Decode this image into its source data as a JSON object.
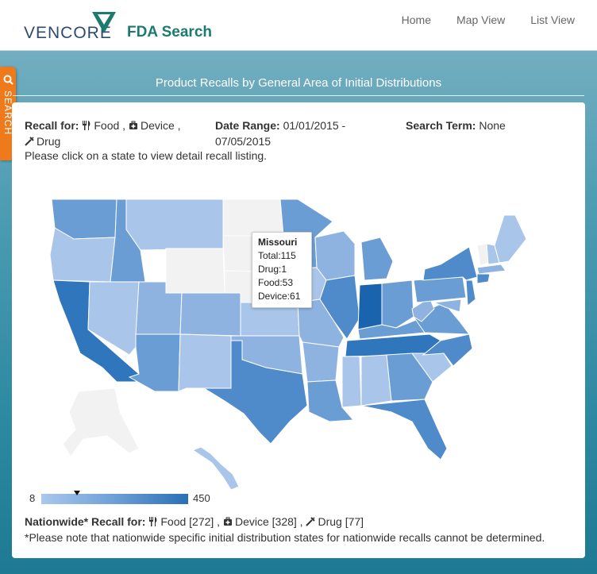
{
  "header": {
    "brand": "VENCORE",
    "app_name": "FDA Search",
    "nav": [
      "Home",
      "Map View",
      "List View"
    ]
  },
  "search_tab": {
    "label": "SEARCH"
  },
  "page": {
    "title": "Product Recalls by General Area of Initial Distributions"
  },
  "filters": {
    "recall_label": "Recall for:",
    "food": "Food",
    "device": "Device",
    "drug": "Drug",
    "date_label": "Date Range:",
    "date_value_1": "01/01/2015 -",
    "date_value_2": "07/05/2015",
    "term_label": "Search Term:",
    "term_value": "None",
    "instruction": "Please click on a state to view detail recall listing."
  },
  "tooltip": {
    "state": "Missouri",
    "total": "Total:115",
    "drug": "Drug:1",
    "food": "Food:53",
    "device": "Device:61"
  },
  "legend": {
    "min": "8",
    "max": "450",
    "marker_value": 115
  },
  "nationwide": {
    "label": "Nationwide* Recall for:",
    "food": "Food [272]",
    "device": "Device [328]",
    "drug": "Drug [77]",
    "note": "*Please note that nationwide specific initial distribution states for nationwide recalls cannot be determined."
  },
  "colors": {
    "empty": "#f2f2f2",
    "light": "#a9c6ea",
    "mid_light": "#8fb3e0",
    "mid": "#6b9dd5",
    "dark": "#4f8bcb",
    "darker": "#2f76bd",
    "darkest": "#1a63ad",
    "accent_orange": "#ef7a1b",
    "brand_teal": "#1c7a6f"
  }
}
